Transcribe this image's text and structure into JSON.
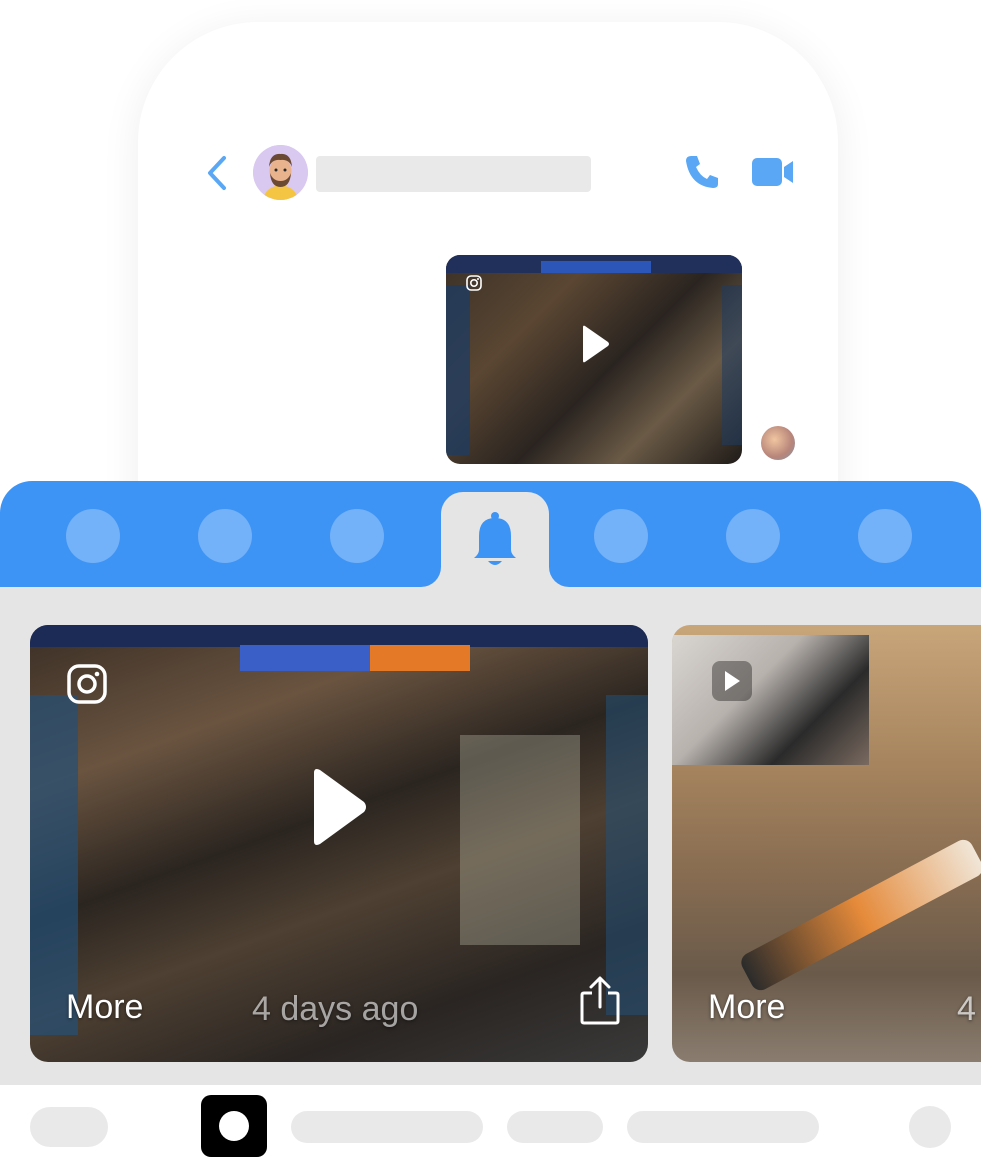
{
  "colors": {
    "accent": "#3d94f5",
    "icon_blue": "#5aa7f5",
    "panel_gray": "#e5e5e6",
    "placeholder_gray": "#e9e9ea"
  },
  "chat_header": {
    "back_icon": "chevron-left-icon",
    "contact_name": "",
    "call_icon": "phone-icon",
    "video_icon": "video-camera-icon"
  },
  "tabbar": {
    "active_icon": "bell-icon",
    "tab_count": 7
  },
  "cards": [
    {
      "more_label": "More",
      "date_label": "4 days ago",
      "share_icon": "share-icon",
      "source_icon": "instagram-icon"
    },
    {
      "more_label": "More",
      "date_label": "4"
    }
  ]
}
